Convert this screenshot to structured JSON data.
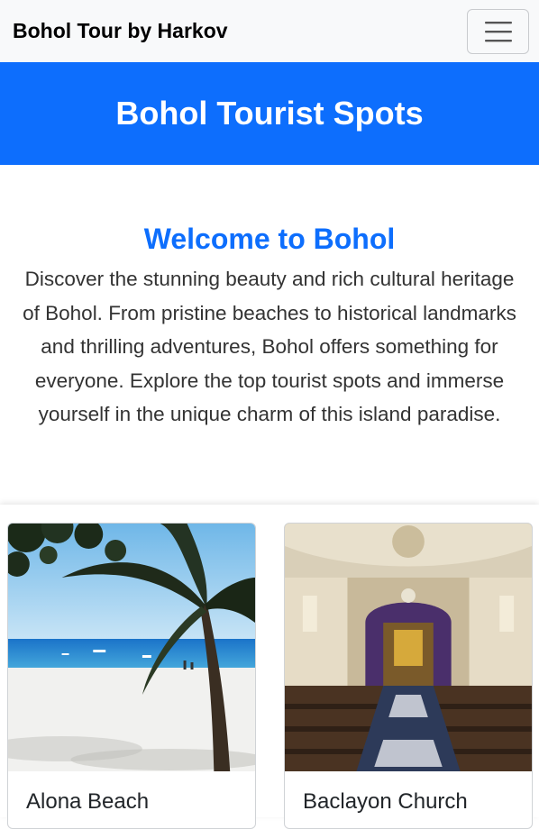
{
  "navbar": {
    "brand": "Bohol Tour by Harkov",
    "toggler_icon": "hamburger-menu-icon"
  },
  "banner": {
    "title": "Bohol Tourist Spots"
  },
  "welcome": {
    "heading": "Welcome to Bohol",
    "lines": [
      "Discover the stunning beauty and rich cultural heritage",
      "of Bohol. From pristine beaches to historical landmarks",
      "and thrilling adventures, Bohol offers something for",
      "everyone. Explore the top tourist spots and immerse",
      "yourself in the unique charm of this island paradise."
    ]
  },
  "spots": [
    {
      "title": "Alona Beach"
    },
    {
      "title": "Baclayon Church"
    }
  ],
  "colors": {
    "primary": "#0d6efd",
    "navbar_bg": "#f8f9fa"
  }
}
